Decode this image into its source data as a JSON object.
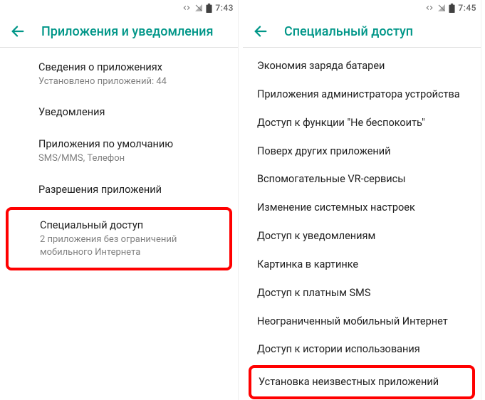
{
  "left": {
    "status": {
      "time": "7:43"
    },
    "header": {
      "title": "Приложения и уведомления"
    },
    "items": [
      {
        "title": "Сведения о приложениях",
        "sub": "Установлено приложений: 44"
      },
      {
        "title": "Уведомления",
        "sub": ""
      },
      {
        "title": "Приложения по умолчанию",
        "sub": "SMS/MMS, Телефон"
      },
      {
        "title": "Разрешения приложений",
        "sub": ""
      },
      {
        "title": "Специальный доступ",
        "sub": "2 приложения без ограничений мобильного Интернета",
        "highlight": true
      }
    ]
  },
  "right": {
    "status": {
      "time": "7:45"
    },
    "header": {
      "title": "Специальный доступ"
    },
    "items": [
      {
        "title": "Экономия заряда батареи"
      },
      {
        "title": "Приложения администратора устройства"
      },
      {
        "title": "Доступ к функции \"Не беспокоить\""
      },
      {
        "title": "Поверх других приложений"
      },
      {
        "title": "Вспомогательные VR-сервисы"
      },
      {
        "title": "Изменение системных настроек"
      },
      {
        "title": "Доступ к уведомлениям"
      },
      {
        "title": "Картинка в картинке"
      },
      {
        "title": "Доступ к платным SMS"
      },
      {
        "title": "Неограниченный мобильный Интернет"
      },
      {
        "title": "Доступ к истории использования"
      },
      {
        "title": "Установка неизвестных приложений",
        "highlight": true
      }
    ]
  }
}
